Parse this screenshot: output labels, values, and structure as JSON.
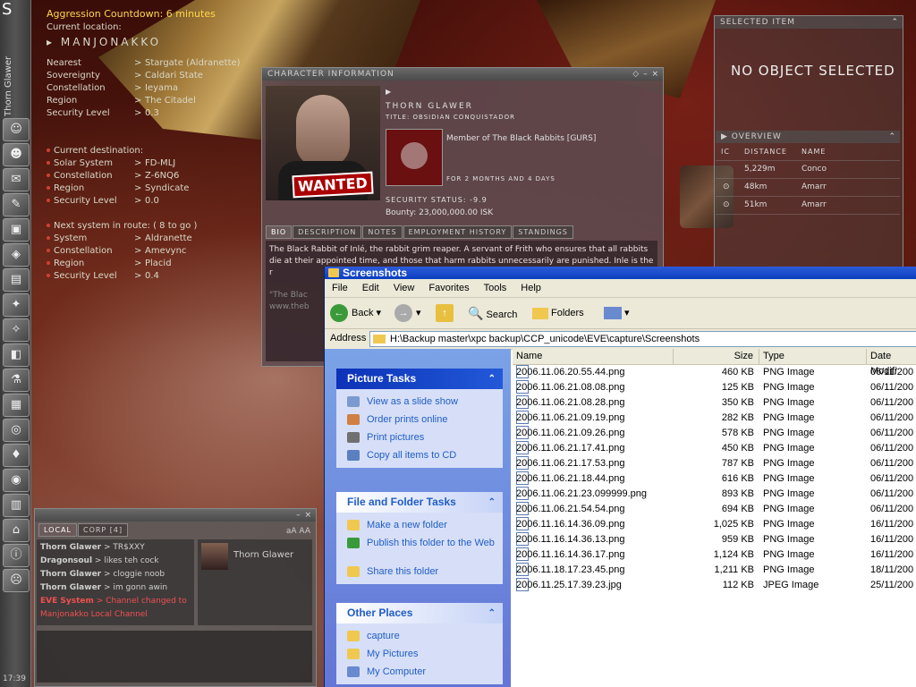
{
  "overlay": {
    "aggression": "Aggression Countdown: 6 minutes",
    "current_location_label": "Current location:",
    "system_name": "MANJONAKKO",
    "location_rows": [
      {
        "label": "Nearest",
        "value": "Stargate (Aldranette)"
      },
      {
        "label": "Sovereignty",
        "value": "Caldari State"
      },
      {
        "label": "Constellation",
        "value": "Ieyama"
      },
      {
        "label": "Region",
        "value": "The Citadel"
      },
      {
        "label": "Security Level",
        "value": "0.3"
      }
    ],
    "destination_label": "Current destination:",
    "destination_rows": [
      {
        "label": "Solar System",
        "value": "FD-MLJ"
      },
      {
        "label": "Constellation",
        "value": "Z-6NQ6"
      },
      {
        "label": "Region",
        "value": "Syndicate"
      },
      {
        "label": "Security Level",
        "value": "0.0"
      }
    ],
    "next_label": "Next system in route: ( 8 to go )",
    "next_rows": [
      {
        "label": "System",
        "value": "Aldranette"
      },
      {
        "label": "Constellation",
        "value": "Amevync"
      },
      {
        "label": "Region",
        "value": "Placid"
      },
      {
        "label": "Security Level",
        "value": "0.4"
      }
    ]
  },
  "neocom": {
    "char_name": "Thorn Glawer",
    "clock": "17:39",
    "top_label": "S"
  },
  "charinfo": {
    "title": "CHARACTER INFORMATION",
    "name": "THORN GLAWER",
    "title_line": "TITLE: OBSIDIAN CONQUISTADOR",
    "member": "Member of The Black Rabbits [GURS]",
    "duration": "FOR 2 MONTHS AND 4 DAYS",
    "security": "SECURITY STATUS: -9.9",
    "bounty": "Bounty: 23,000,000.00 ISK",
    "wanted": "WANTED",
    "tabs": [
      "BIO",
      "DESCRIPTION",
      "NOTES",
      "EMPLOYMENT HISTORY",
      "STANDINGS"
    ],
    "bio_text": "The Black Rabbit of Inlé, the rabbit grim reaper. A servant of Frith who ensures that all rabbits die at their appointed time, and those that harm rabbits unnecessarily are punished. Inle is the r",
    "bio_quote": "\"The Blac",
    "bio_link": "www.theb"
  },
  "selected_item": {
    "title": "SELECTED ITEM",
    "text": "NO OBJECT SELECTED"
  },
  "overview": {
    "title": "OVERVIEW",
    "headers": [
      "IC",
      "DISTANCE",
      "NAME"
    ],
    "rows": [
      {
        "icon": "",
        "distance": "5,229m",
        "name": "Conco"
      },
      {
        "icon": "⊙",
        "distance": "48km",
        "name": "Amarr"
      },
      {
        "icon": "⊙",
        "distance": "51km",
        "name": "Amarr"
      }
    ]
  },
  "chat": {
    "tabs": [
      "LOCAL",
      "CORP [4]"
    ],
    "messages": [
      {
        "who": "Thorn Glawer",
        "text": "TR$XXY",
        "system": false
      },
      {
        "who": "Dragonsoul",
        "text": "likes teh cock",
        "system": false
      },
      {
        "who": "Thorn Glawer",
        "text": "cloggie noob",
        "system": false
      },
      {
        "who": "Thorn Glawer",
        "text": "im gonn awin",
        "system": false
      },
      {
        "who": "EVE System",
        "text": "Channel changed to Manjonakko Local Channel",
        "system": true
      }
    ],
    "member": "Thorn Glawer",
    "toolbar": "aA  AA"
  },
  "explorer": {
    "title": "Screenshots",
    "menu": [
      "File",
      "Edit",
      "View",
      "Favorites",
      "Tools",
      "Help"
    ],
    "toolbar": {
      "back": "Back",
      "search": "Search",
      "folders": "Folders"
    },
    "address_label": "Address",
    "address": "H:\\Backup master\\xpc backup\\CCP_unicode\\EVE\\capture\\Screenshots",
    "picture_tasks": {
      "title": "Picture Tasks",
      "items": [
        "View as a slide show",
        "Order prints online",
        "Print pictures",
        "Copy all items to CD"
      ]
    },
    "file_tasks": {
      "title": "File and Folder Tasks",
      "items": [
        "Make a new folder",
        "Publish this folder to the Web",
        "Share this folder"
      ]
    },
    "other_places": {
      "title": "Other Places",
      "items": [
        "capture",
        "My Pictures",
        "My Computer"
      ]
    },
    "columns": [
      "Name",
      "Size",
      "Type",
      "Date Modifi"
    ],
    "files": [
      {
        "name": "2006.11.06.20.55.44.png",
        "size": "460 KB",
        "type": "PNG Image",
        "date": "06/11/200"
      },
      {
        "name": "2006.11.06.21.08.08.png",
        "size": "125 KB",
        "type": "PNG Image",
        "date": "06/11/200"
      },
      {
        "name": "2006.11.06.21.08.28.png",
        "size": "350 KB",
        "type": "PNG Image",
        "date": "06/11/200"
      },
      {
        "name": "2006.11.06.21.09.19.png",
        "size": "282 KB",
        "type": "PNG Image",
        "date": "06/11/200"
      },
      {
        "name": "2006.11.06.21.09.26.png",
        "size": "578 KB",
        "type": "PNG Image",
        "date": "06/11/200"
      },
      {
        "name": "2006.11.06.21.17.41.png",
        "size": "450 KB",
        "type": "PNG Image",
        "date": "06/11/200"
      },
      {
        "name": "2006.11.06.21.17.53.png",
        "size": "787 KB",
        "type": "PNG Image",
        "date": "06/11/200"
      },
      {
        "name": "2006.11.06.21.18.44.png",
        "size": "616 KB",
        "type": "PNG Image",
        "date": "06/11/200"
      },
      {
        "name": "2006.11.06.21.23.099999.png",
        "size": "893 KB",
        "type": "PNG Image",
        "date": "06/11/200"
      },
      {
        "name": "2006.11.06.21.54.54.png",
        "size": "694 KB",
        "type": "PNG Image",
        "date": "06/11/200"
      },
      {
        "name": "2006.11.16.14.36.09.png",
        "size": "1,025 KB",
        "type": "PNG Image",
        "date": "16/11/200"
      },
      {
        "name": "2006.11.16.14.36.13.png",
        "size": "959 KB",
        "type": "PNG Image",
        "date": "16/11/200"
      },
      {
        "name": "2006.11.16.14.36.17.png",
        "size": "1,124 KB",
        "type": "PNG Image",
        "date": "16/11/200"
      },
      {
        "name": "2006.11.18.17.23.45.png",
        "size": "1,211 KB",
        "type": "PNG Image",
        "date": "18/11/200"
      },
      {
        "name": "2006.11.25.17.39.23.jpg",
        "size": "112 KB",
        "type": "JPEG Image",
        "date": "25/11/200"
      }
    ]
  }
}
